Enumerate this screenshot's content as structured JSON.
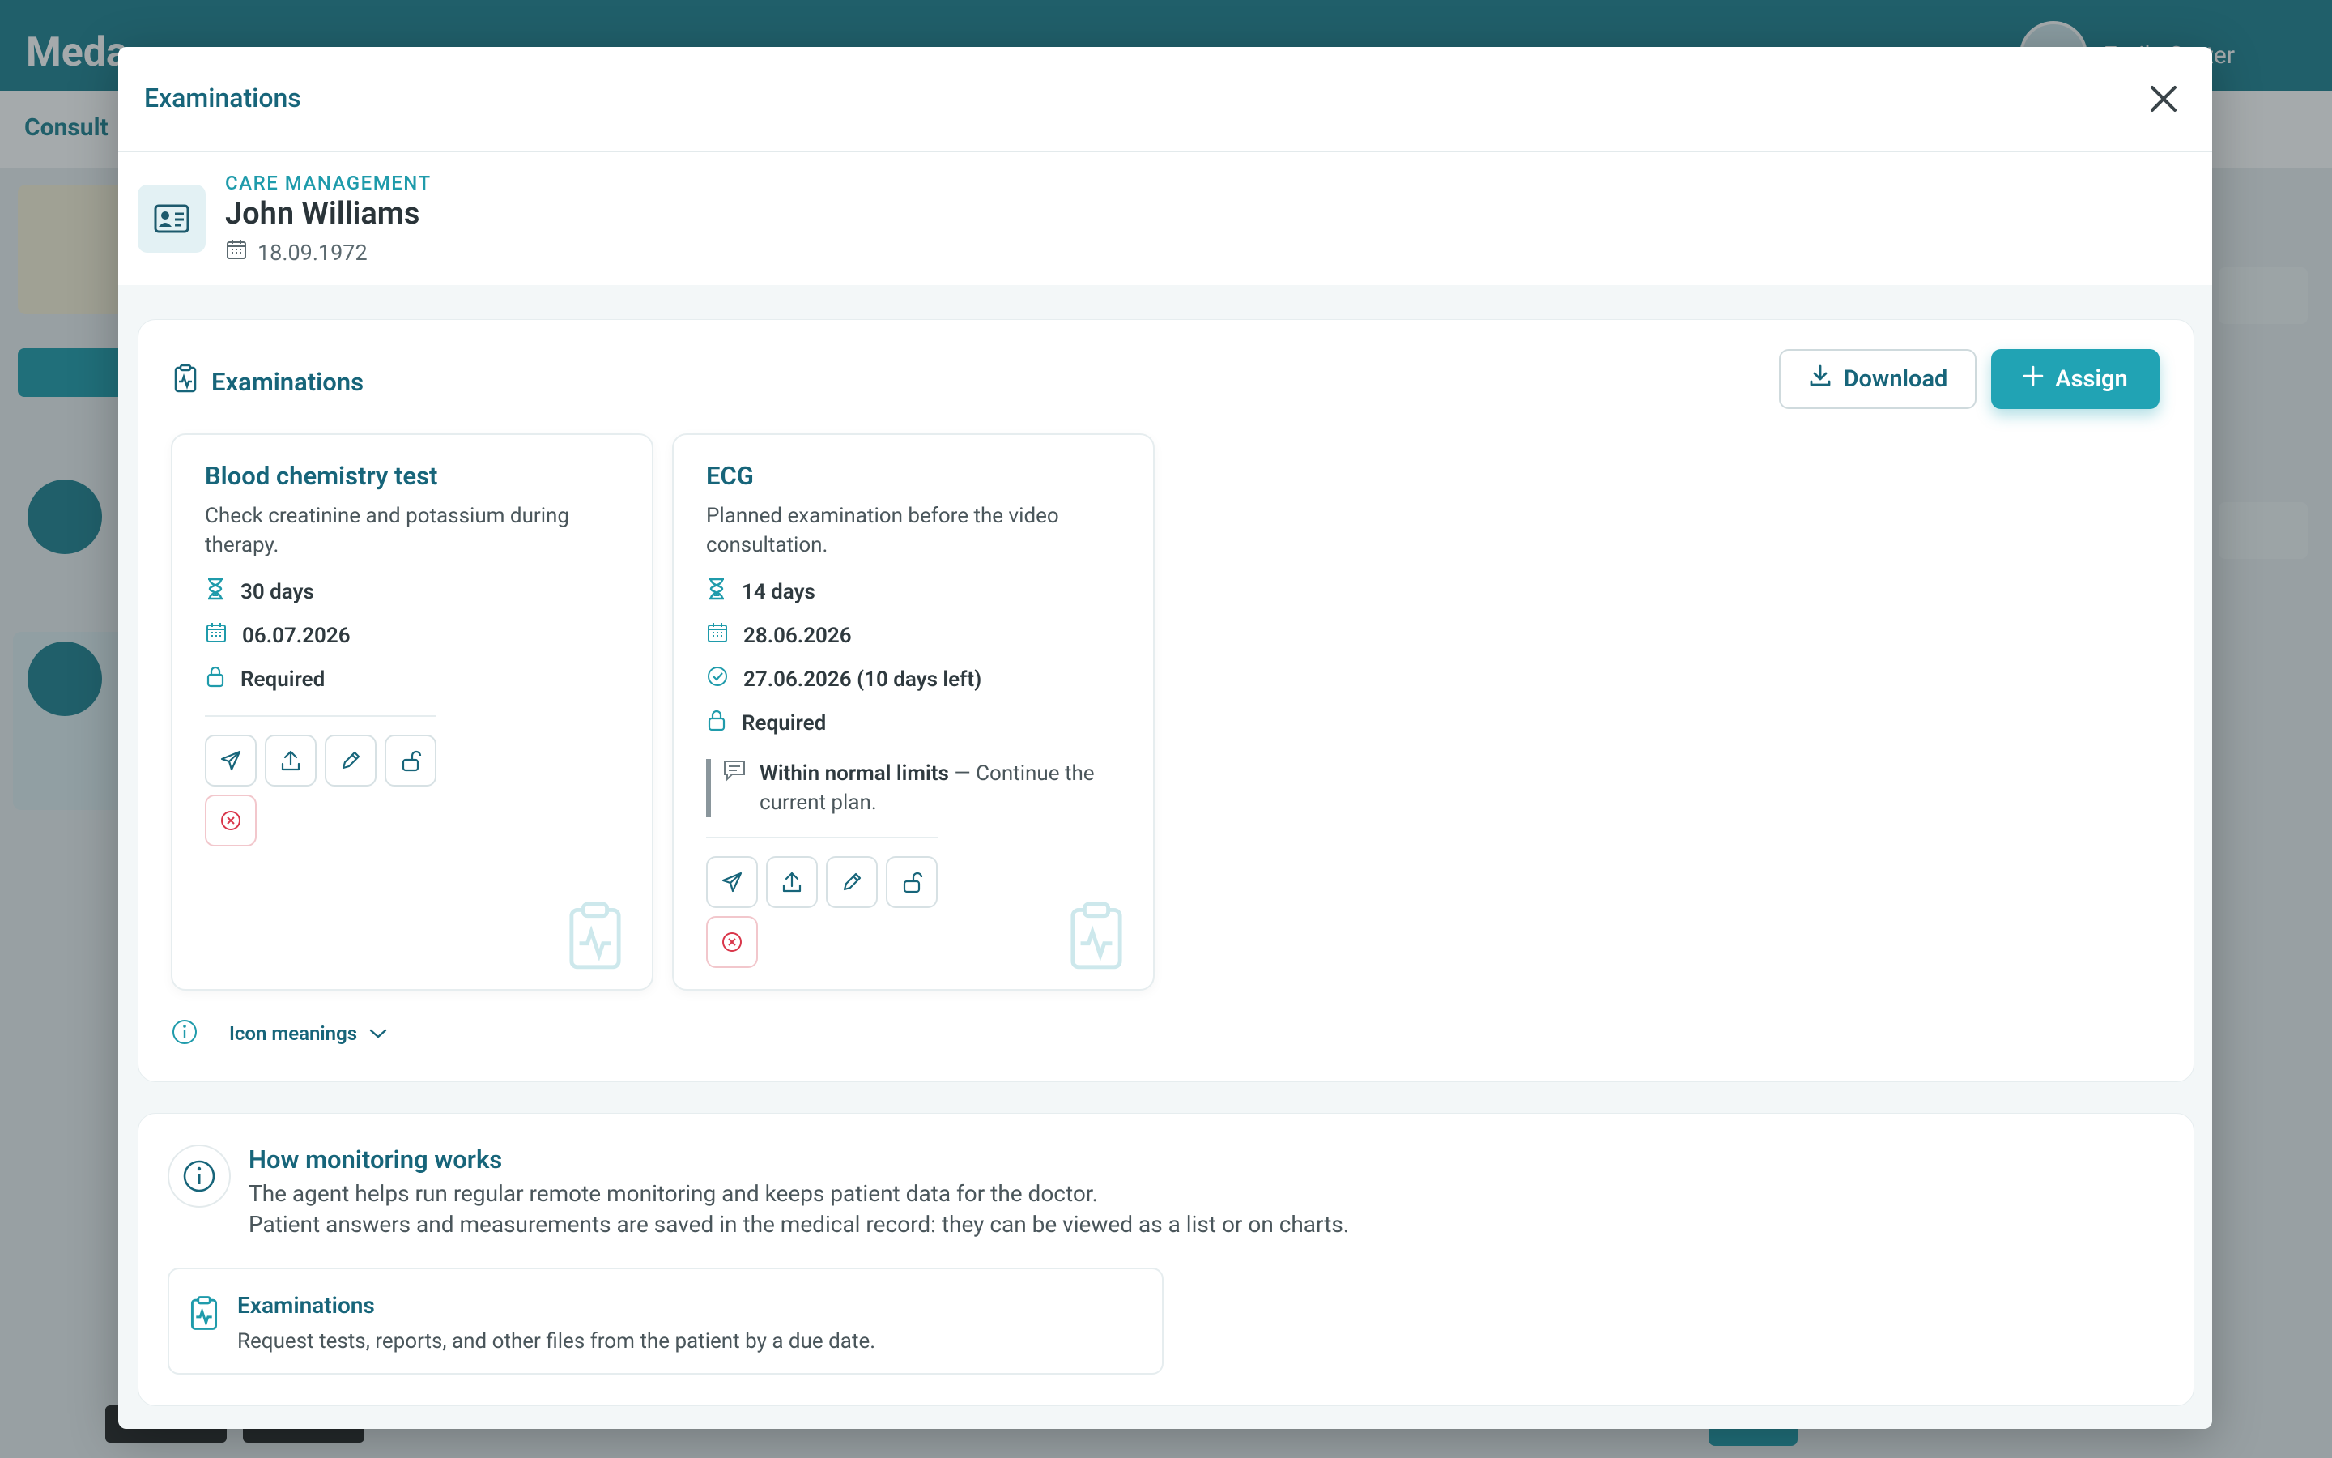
{
  "background": {
    "brand": "Meda",
    "user_name": "Emily Carter",
    "subnav_label": "Consult"
  },
  "modal": {
    "title": "Examinations"
  },
  "patient": {
    "kicker": "CARE MANAGEMENT",
    "name": "John Williams",
    "dob": "18.09.1972"
  },
  "exams": {
    "section_title": "Examinations",
    "download_label": "Download",
    "assign_label": "Assign",
    "cards": [
      {
        "title": "Blood chemistry test",
        "description": "Check creatinine and potassium during therapy.",
        "duration": "30 days",
        "due_date": "06.07.2026",
        "requirement": "Required"
      },
      {
        "title": "ECG",
        "description": "Planned examination before the video consultation.",
        "duration": "14 days",
        "due_date": "28.06.2026",
        "completed": "27.06.2026 (10 days left)",
        "requirement": "Required",
        "result_label": "Within normal limits",
        "result_text": " — Continue the current plan."
      }
    ],
    "legend_label": "Icon meanings"
  },
  "how": {
    "title": "How monitoring works",
    "line1": "The agent helps run regular remote monitoring and keeps patient data for the doctor.",
    "line2": "Patient answers and measurements are saved in the medical record: they can be viewed as a list or on charts.",
    "card_title": "Examinations",
    "card_desc": "Request tests, reports, and other files from the patient by a due date."
  },
  "colors": {
    "accent": "#21a3b4",
    "heading": "#17657a",
    "danger": "#d9364a"
  },
  "icons": [
    "close-icon",
    "id-card-icon",
    "calendar-icon",
    "clipboard-pulse-icon",
    "download-icon",
    "plus-icon",
    "hourglass-icon",
    "lock-icon",
    "check-circle-icon",
    "comment-icon",
    "send-icon",
    "upload-icon",
    "pencil-icon",
    "unlock-icon",
    "cancel-icon",
    "info-icon",
    "chevron-down-icon"
  ]
}
